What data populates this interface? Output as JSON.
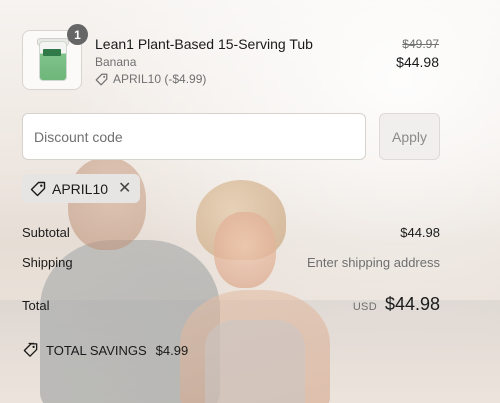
{
  "product": {
    "quantity_badge": "1",
    "title": "Lean1 Plant-Based 15-Serving Tub",
    "variant": "Banana",
    "discount_note": "APRIL10 (-$4.99)",
    "original_price": "$49.97",
    "price": "$44.98",
    "icons": {
      "tag": "tag-icon",
      "thumbnail": "product-tub-image"
    }
  },
  "discount": {
    "placeholder": "Discount code",
    "value": "",
    "apply_label": "Apply",
    "applied_code": "APRIL10",
    "remove_icon": "close-icon"
  },
  "summary": {
    "subtotal_label": "Subtotal",
    "subtotal_value": "$44.98",
    "shipping_label": "Shipping",
    "shipping_value": "Enter shipping address",
    "total_label": "Total",
    "currency": "USD",
    "total_value": "$44.98",
    "savings_label": "TOTAL SAVINGS",
    "savings_value": "$4.99"
  },
  "colors": {
    "text": "#1a1a1a",
    "muted": "#707070",
    "badge": "#666666",
    "chip_bg": "#e7e5e4",
    "button_bg": "#f1efed"
  }
}
